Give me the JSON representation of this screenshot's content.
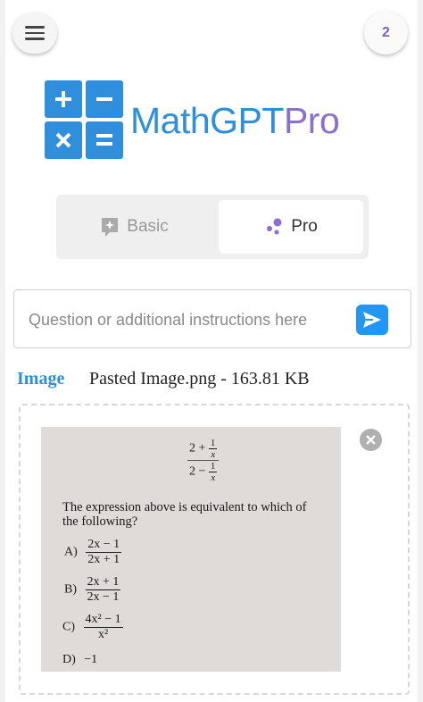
{
  "header": {
    "menu_icon": "hamburger-menu-icon",
    "counter": "2"
  },
  "logo": {
    "text_main": "MathGPT",
    "text_accent": "Pro",
    "icon": "calculator-operators-icon",
    "brand_blue": "#2f8fdc",
    "brand_purple": "#8a6fd1"
  },
  "mode_toggle": {
    "basic_label": "Basic",
    "basic_icon": "sparkle-chat-icon",
    "pro_label": "Pro",
    "pro_icon": "dots-cluster-icon",
    "selected": "Pro"
  },
  "prompt": {
    "placeholder": "Question or additional instructions here",
    "value": "",
    "send_icon": "send-arrow-icon"
  },
  "attachment": {
    "label": "Image",
    "info": "Pasted Image.png - 163.81 KB",
    "remove_icon": "close-circle-icon"
  },
  "question": {
    "expr_num_lead": "2 +",
    "expr_den_lead": "2 −",
    "inner_num": "1",
    "inner_den": "x",
    "prompt_line1": "The expression above is equivalent to which of",
    "prompt_line2": "the following?",
    "options": [
      {
        "letter": "A)",
        "num": "2x − 1",
        "den": "2x + 1"
      },
      {
        "letter": "B)",
        "num": "2x + 1",
        "den": "2x − 1"
      },
      {
        "letter": "C)",
        "num": "4x² − 1",
        "den": "x²"
      },
      {
        "letter": "D)",
        "text": "−1"
      }
    ]
  }
}
